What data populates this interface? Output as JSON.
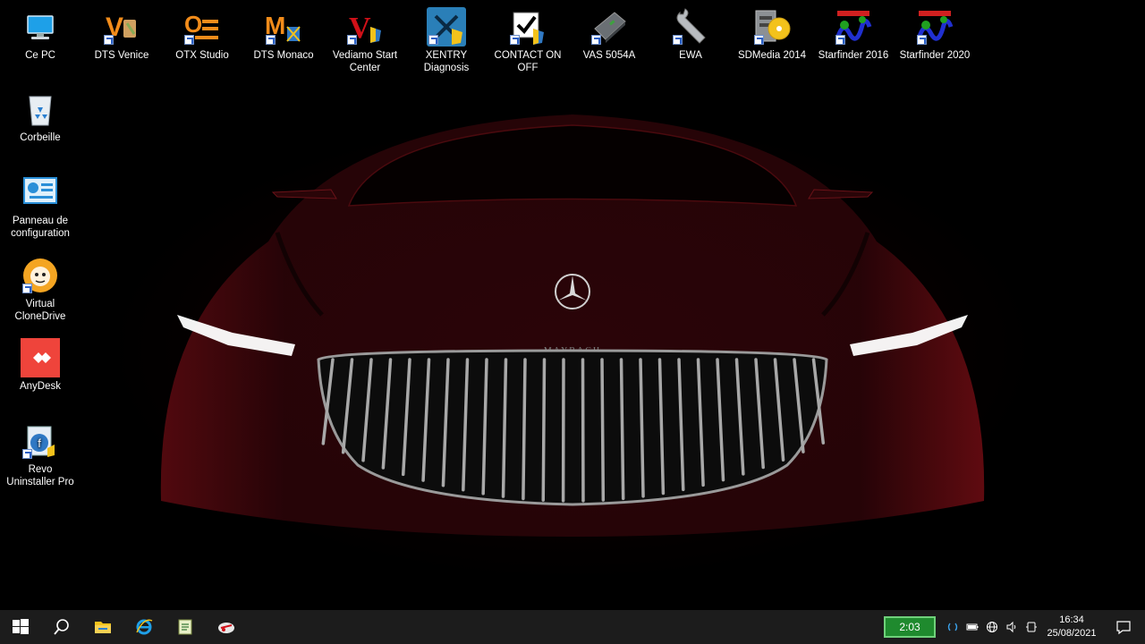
{
  "desktop": {
    "left_icons": [
      {
        "label": "Ce PC"
      },
      {
        "label": "Corbeille"
      },
      {
        "label": "Panneau de configuration"
      },
      {
        "label": "Virtual CloneDrive"
      },
      {
        "label": "AnyDesk"
      },
      {
        "label": "Revo Uninstaller Pro"
      }
    ],
    "top_icons": [
      {
        "label": "DTS Venice"
      },
      {
        "label": "OTX Studio"
      },
      {
        "label": "DTS Monaco"
      },
      {
        "label": "Vediamo Start Center"
      },
      {
        "label": "XENTRY Diagnosis"
      },
      {
        "label": "CONTACT ON OFF"
      },
      {
        "label": "VAS 5054A"
      },
      {
        "label": "EWA"
      },
      {
        "label": "SDMedia 2014"
      },
      {
        "label": "Starfinder 2016"
      },
      {
        "label": "Starfinder 2020"
      }
    ],
    "wallpaper_badge": "MAYBACH"
  },
  "taskbar": {
    "pinned": [
      "windows-start-icon",
      "search-icon",
      "file-explorer-icon",
      "internet-explorer-icon",
      "notepad-icon",
      "xentry-pinned-icon"
    ],
    "timer": "2:03",
    "clock_time": "16:34",
    "clock_date": "25/08/2021"
  },
  "colors": {
    "taskbar_bg": "#1c1c1c",
    "timer_bg": "#1f8a2e",
    "accent_red": "#8a0a10"
  }
}
